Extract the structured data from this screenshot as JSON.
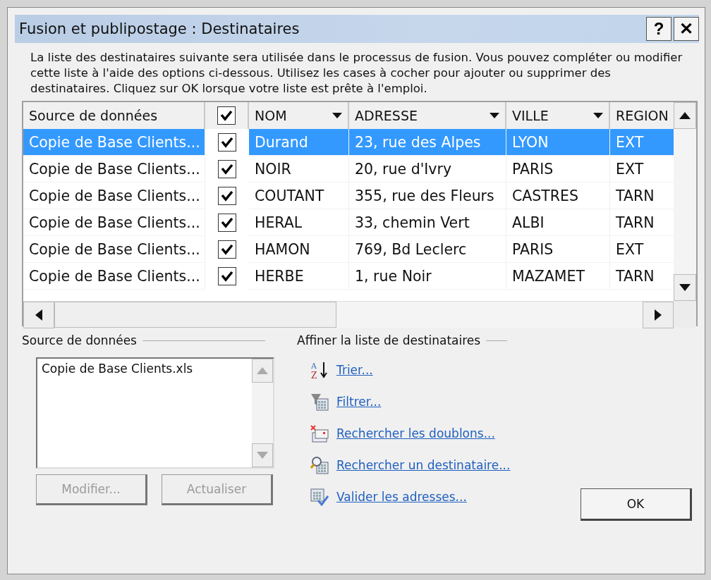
{
  "window": {
    "title": "Fusion et publipostage : Destinataires",
    "help_button": "?",
    "close_button": "✕"
  },
  "description": "La liste des destinataires suivante sera utilisée dans le processus de fusion. Vous pouvez compléter ou modifier cette liste à l'aide des options ci-dessous. Utilisez les cases à cocher pour ajouter ou supprimer des destinataires. Cliquez sur OK lorsque votre liste est prête à l'emploi.",
  "table": {
    "columns": [
      {
        "label": "Source de données",
        "kind": "text"
      },
      {
        "kind": "check",
        "checked": true
      },
      {
        "label": "NOM",
        "kind": "dropdown"
      },
      {
        "label": "ADRESSE",
        "kind": "dropdown"
      },
      {
        "label": "VILLE",
        "kind": "dropdown"
      },
      {
        "label": "REGION",
        "kind": "text"
      }
    ],
    "rows": [
      {
        "source": "Copie de Base Clients...",
        "checked": true,
        "nom": "Durand",
        "adresse": "23, rue des Alpes",
        "ville": "LYON",
        "region": "EXT",
        "selected": true
      },
      {
        "source": "Copie de Base Clients...",
        "checked": true,
        "nom": "NOIR",
        "adresse": "20, rue d'Ivry",
        "ville": "PARIS",
        "region": "EXT",
        "selected": false
      },
      {
        "source": "Copie de Base Clients...",
        "checked": true,
        "nom": "COUTANT",
        "adresse": "355, rue des Fleurs",
        "ville": "CASTRES",
        "region": "TARN",
        "selected": false
      },
      {
        "source": "Copie de Base Clients...",
        "checked": true,
        "nom": "HERAL",
        "adresse": "33, chemin Vert",
        "ville": "ALBI",
        "region": "TARN",
        "selected": false
      },
      {
        "source": "Copie de Base Clients...",
        "checked": true,
        "nom": "HAMON",
        "adresse": "769, Bd Leclerc",
        "ville": "PARIS",
        "region": "EXT",
        "selected": false
      },
      {
        "source": "Copie de Base Clients...",
        "checked": true,
        "nom": "HERBE",
        "adresse": "1, rue Noir",
        "ville": "MAZAMET",
        "region": "TARN",
        "selected": false
      }
    ]
  },
  "source_group": {
    "title": "Source de données",
    "items": [
      "Copie de Base Clients.xls"
    ],
    "buttons": [
      {
        "label": "Modifier...",
        "disabled": true
      },
      {
        "label": "Actualiser",
        "disabled": true
      }
    ]
  },
  "refine_group": {
    "title": "Affiner la liste de destinataires",
    "links": [
      {
        "label": "Trier...",
        "kind": "sort",
        "icon_letters": [
          "A",
          "Z"
        ]
      },
      {
        "label": "Filtrer...",
        "kind": "filter"
      },
      {
        "label": "Rechercher les doublons...",
        "kind": "duplicates"
      },
      {
        "label": "Rechercher un destinataire...",
        "kind": "find"
      },
      {
        "label": "Valider les adresses...",
        "kind": "validate"
      }
    ]
  },
  "ok_button": "OK"
}
